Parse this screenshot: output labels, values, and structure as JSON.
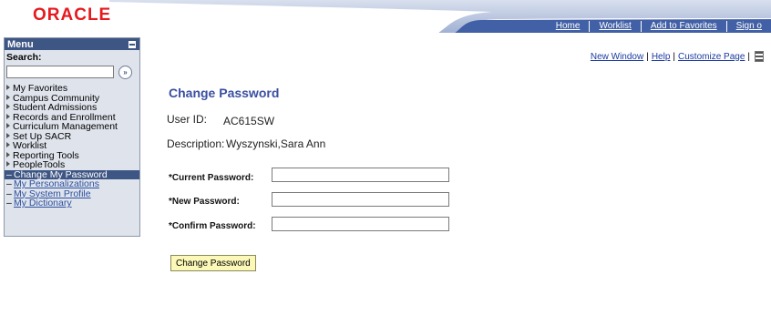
{
  "header": {
    "logo_text": "ORACLE",
    "nav": [
      "Home",
      "Worklist",
      "Add to Favorites",
      "Sign o"
    ]
  },
  "menu": {
    "title": "Menu",
    "search_label": "Search:",
    "search_value": "",
    "items": [
      {
        "label": "My Favorites",
        "kind": "folder"
      },
      {
        "label": "Campus Community",
        "kind": "folder"
      },
      {
        "label": "Student Admissions",
        "kind": "folder"
      },
      {
        "label": "Records and Enrollment",
        "kind": "folder"
      },
      {
        "label": "Curriculum Management",
        "kind": "folder"
      },
      {
        "label": "Set Up SACR",
        "kind": "folder"
      },
      {
        "label": "Worklist",
        "kind": "folder"
      },
      {
        "label": "Reporting Tools",
        "kind": "folder"
      },
      {
        "label": "PeopleTools",
        "kind": "folder"
      },
      {
        "label": "Change My Password",
        "kind": "active"
      },
      {
        "label": "My Personalizations",
        "kind": "sub"
      },
      {
        "label": "My System Profile",
        "kind": "sub"
      },
      {
        "label": "My Dictionary",
        "kind": "sub"
      }
    ]
  },
  "util_links": {
    "new_window": "New Window",
    "help": "Help",
    "customize": "Customize Page",
    "sep": "|"
  },
  "page": {
    "title": "Change Password",
    "user_id_label": "User ID:",
    "user_id_value": "AC615SW",
    "description_label": "Description:",
    "description_value": "Wyszynski,Sara Ann",
    "current_pw_label": "*Current Password:",
    "new_pw_label": "*New Password:",
    "confirm_pw_label": "*Confirm Password:",
    "current_pw_value": "",
    "new_pw_value": "",
    "confirm_pw_value": "",
    "submit_label": "Change Password"
  },
  "colors": {
    "brand_red": "#e6191e",
    "banner_blue": "#4160a6",
    "menu_header": "#3e5684",
    "menu_bg": "#dfe4ec",
    "title_blue": "#3a4fa0",
    "button_bg": "#fbf8b8"
  }
}
